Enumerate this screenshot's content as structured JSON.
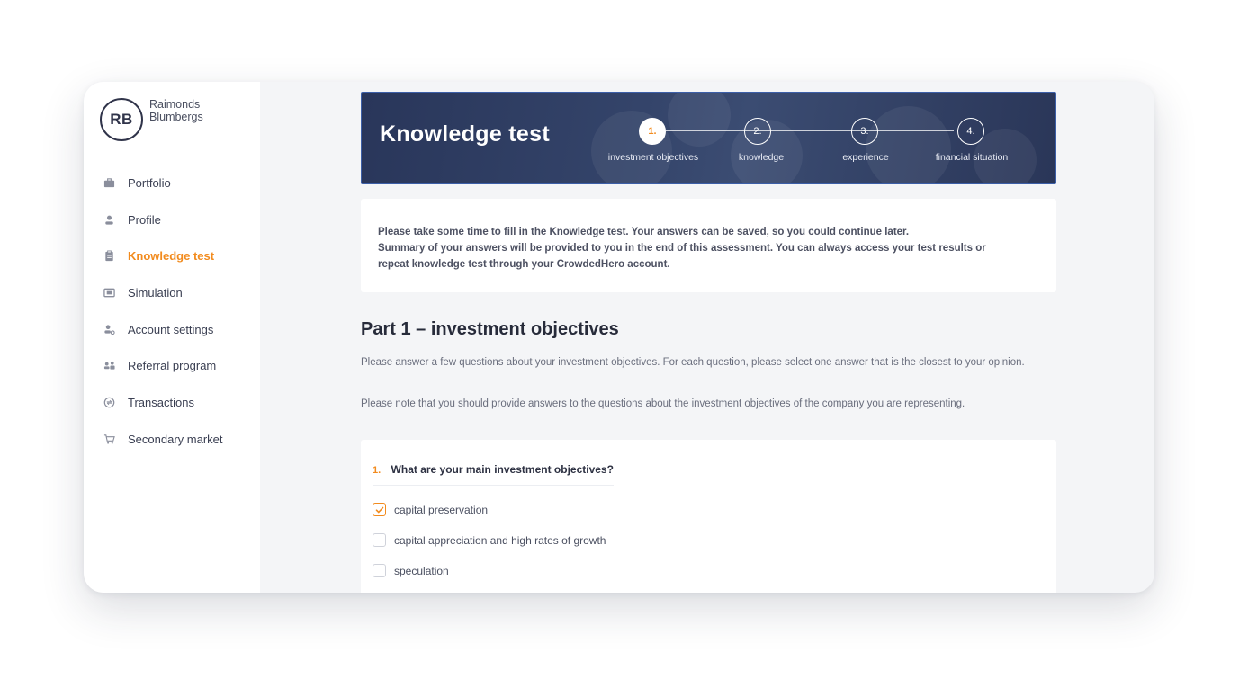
{
  "user": {
    "initials": "RB",
    "first_name": "Raimonds",
    "last_name": "Blumbergs"
  },
  "sidebar": {
    "items": [
      {
        "label": "Portfolio",
        "icon": "briefcase-icon"
      },
      {
        "label": "Profile",
        "icon": "person-icon"
      },
      {
        "label": "Knowledge test",
        "icon": "clipboard-icon",
        "active": true
      },
      {
        "label": "Simulation",
        "icon": "monitor-icon"
      },
      {
        "label": "Account settings",
        "icon": "user-settings-icon"
      },
      {
        "label": "Referral program",
        "icon": "users-icon"
      },
      {
        "label": "Transactions",
        "icon": "circle-transaction-icon"
      },
      {
        "label": "Secondary market",
        "icon": "cart-icon"
      }
    ]
  },
  "banner": {
    "title": "Knowledge test",
    "steps": [
      {
        "number": "1.",
        "label": "investment objectives",
        "active": true
      },
      {
        "number": "2.",
        "label": "knowledge"
      },
      {
        "number": "3.",
        "label": "experience"
      },
      {
        "number": "4.",
        "label": "financial situation"
      }
    ]
  },
  "intro": {
    "line1": "Please take some time to fill in the Knowledge test. Your answers can be saved, so you could continue later.",
    "line2": "Summary of your answers will be provided to you in the end of this assessment. You can always access your test results or",
    "line3": "repeat knowledge test through your CrowdedHero account."
  },
  "part": {
    "title": "Part 1 – investment objectives",
    "description": "Please answer a few questions about your investment objectives. For each question, please select one answer that is the closest to your opinion.",
    "note": "Please note that you should provide answers to the questions about the investment objectives of the company you are representing."
  },
  "question": {
    "number": "1.",
    "text": "What are your main investment objectives?",
    "options": [
      {
        "label": "capital preservation",
        "checked": true
      },
      {
        "label": "capital appreciation and high rates of growth",
        "checked": false
      },
      {
        "label": "speculation",
        "checked": false
      }
    ]
  },
  "colors": {
    "accent": "#f28b1e",
    "banner": "#2f3c60",
    "text": "#2f3342"
  }
}
